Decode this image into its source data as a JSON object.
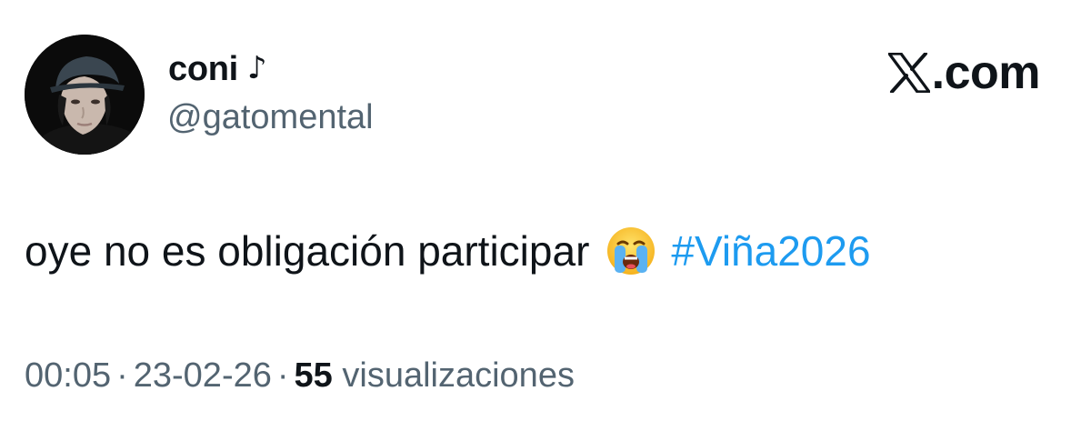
{
  "author": {
    "display_name": "coni",
    "name_suffix_icon": "♪",
    "handle": "@gatomental",
    "avatar_icon": "profile-photo"
  },
  "brand": {
    "text": ".com",
    "logo_icon": "x-logo-icon"
  },
  "tweet": {
    "text": "oye no es obligación participar",
    "emoji_icon": "loudly-crying-face-icon",
    "hashtag": "#Viña2026"
  },
  "meta": {
    "time": "00:05",
    "separator": "·",
    "date": "23-02-26",
    "views_count": "55",
    "views_label": "visualizaciones"
  },
  "colors": {
    "text": "#0f1419",
    "secondary": "#536471",
    "hashtag": "#1d9bf0"
  }
}
